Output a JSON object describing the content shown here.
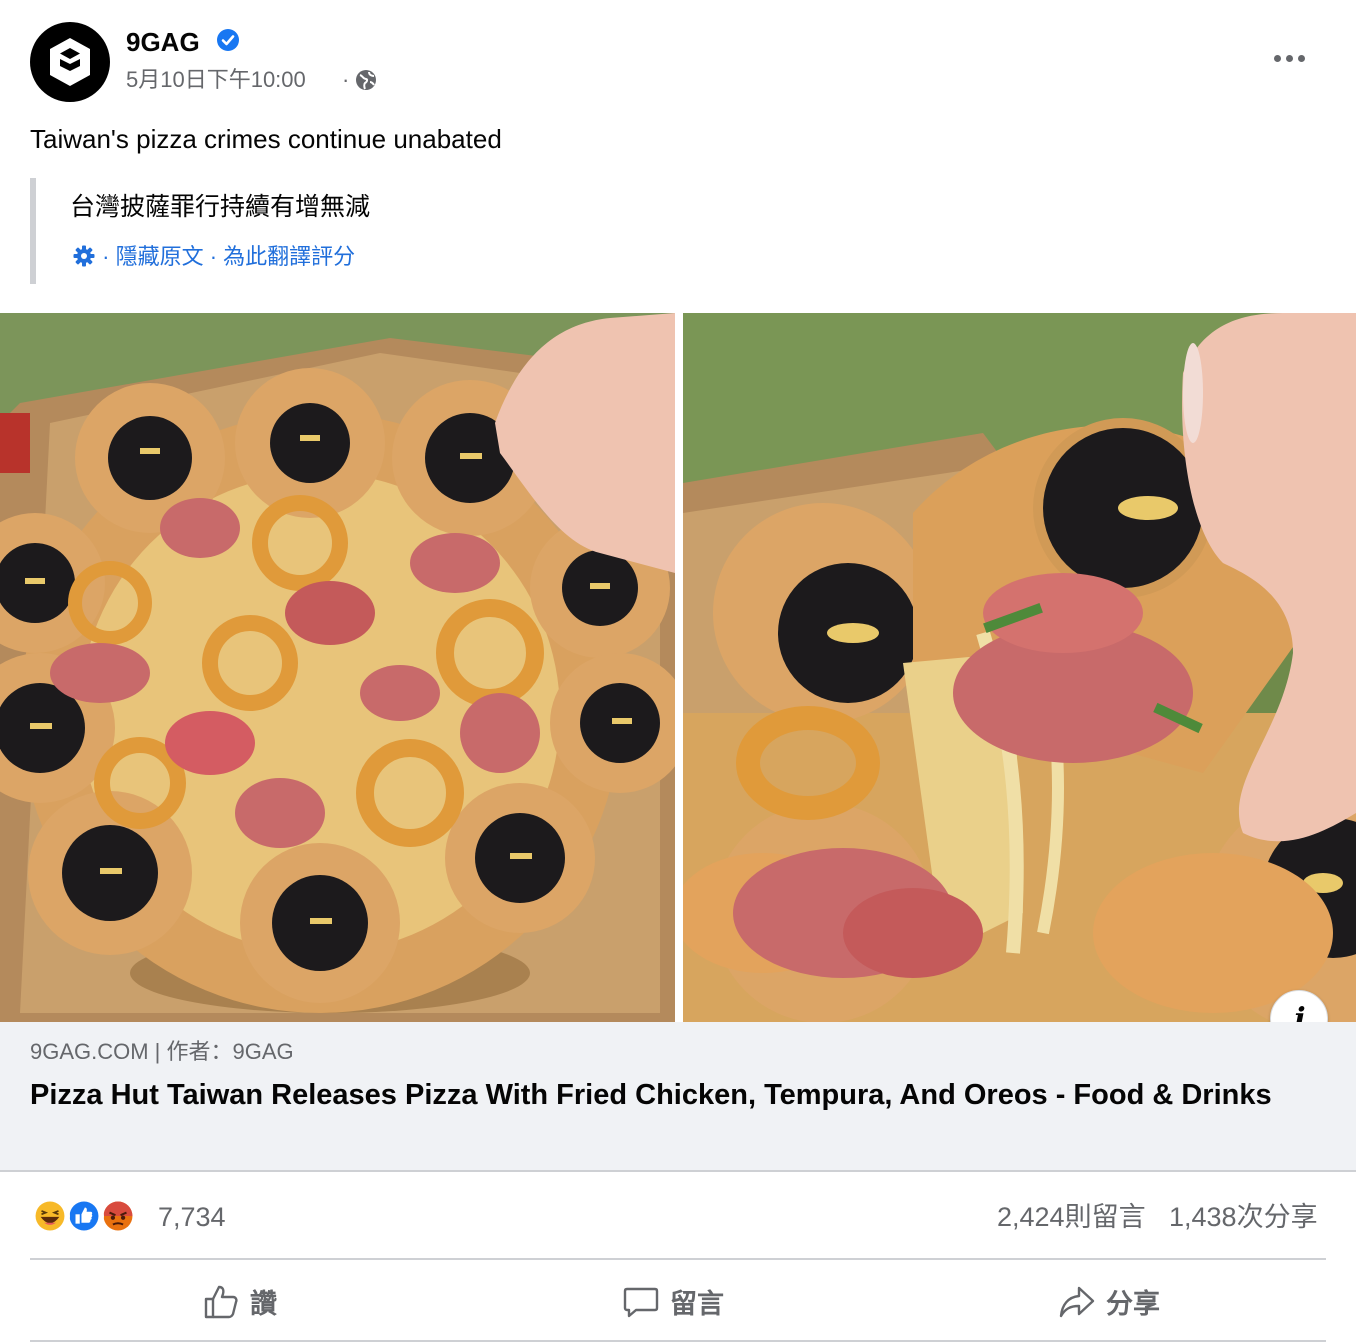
{
  "post": {
    "page_name": "9GAG",
    "timestamp": "5月10日下午10:00",
    "meta_separator": "·",
    "caption": "Taiwan's pizza crimes continue unabated",
    "icons": {
      "avatar": "9gag-logo",
      "verified": "verified-badge-icon",
      "privacy": "globe-icon",
      "more": "more-options-icon"
    }
  },
  "translation": {
    "text": "台灣披薩罪行持續有增無減",
    "separator": "·",
    "hide_original_label": "隱藏原文",
    "rate_translation_label": "為此翻譯評分",
    "settings_icon": "gear-icon"
  },
  "media": {
    "images": [
      {
        "description_icon": "pizza-photo-top-view"
      },
      {
        "description_icon": "pizza-photo-cheese-pull"
      }
    ],
    "info_button_label": "i"
  },
  "link_preview": {
    "source": "9GAG.COM | 作者：9GAG",
    "title": "Pizza Hut Taiwan Releases Pizza With Fried Chicken, Tempura, And Oreos - Food & Drinks"
  },
  "stats": {
    "reactions": [
      "haha",
      "like",
      "angry"
    ],
    "reaction_count": "7,734",
    "comments": "2,424則留言",
    "shares": "1,438次分享"
  },
  "actions": [
    {
      "label": "讚",
      "icon": "like-thumb-icon"
    },
    {
      "label": "留言",
      "icon": "comment-icon"
    },
    {
      "label": "分享",
      "icon": "share-icon"
    }
  ],
  "colors": {
    "link_blue": "#216fdb",
    "secondary_text": "#65676b",
    "card_bg": "#f0f2f5",
    "verified_blue": "#1877f2"
  }
}
